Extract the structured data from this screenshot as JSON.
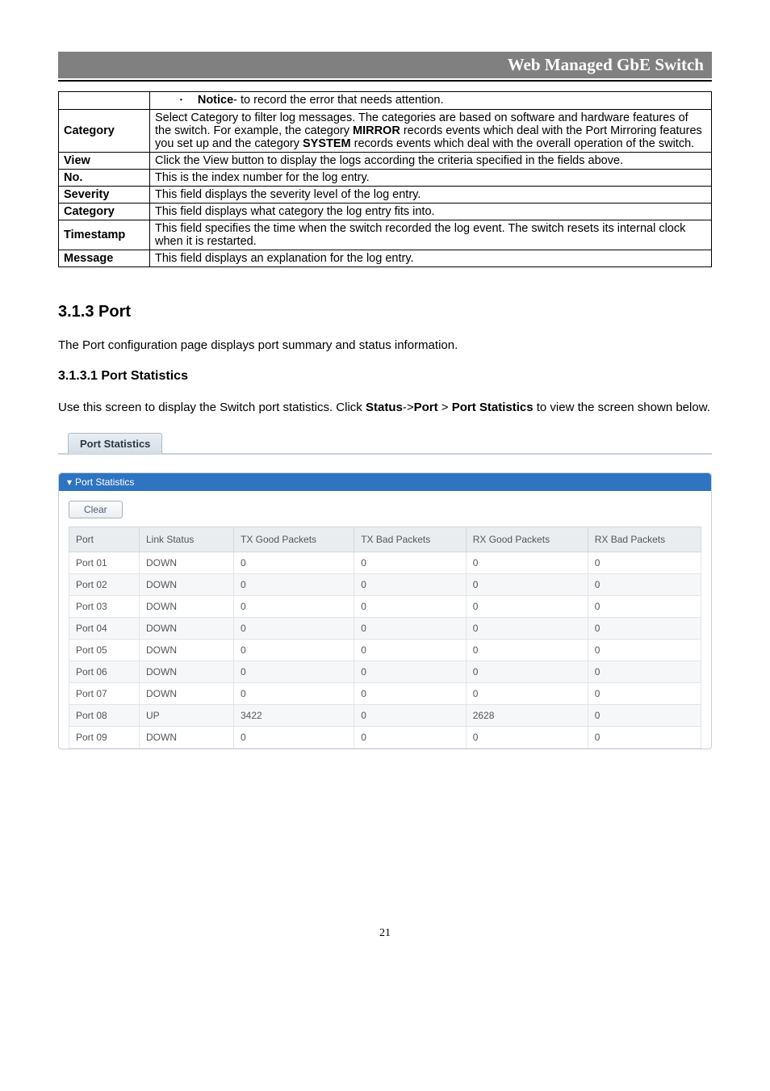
{
  "header": {
    "title": "Web Managed GbE Switch"
  },
  "def_table": {
    "notice_prefix": "Notice",
    "notice_text": "- to record the error that needs attention.",
    "rows": [
      {
        "label": "Category",
        "text_parts": [
          "Select Category to filter log messages. The categories are based on software and hardware features of the switch. For example, the category ",
          "MIRROR",
          " records events which deal with the Port Mirroring features you set up and the category ",
          "SYSTEM",
          " records events which deal with the overall operation of the switch."
        ]
      },
      {
        "label": "View",
        "text": "Click the View button to display the logs according the criteria specified in the fields above."
      },
      {
        "label": "No.",
        "text": "This is the index number for the log entry."
      },
      {
        "label": "Severity",
        "text": "This field displays the severity level of the log entry."
      },
      {
        "label": "Category",
        "text": "This field displays what category the log entry fits into."
      },
      {
        "label": "Timestamp",
        "text": "This field specifies the time when the switch recorded the log event. The switch resets its internal clock when it is restarted."
      },
      {
        "label": "Message",
        "text": "This field displays an explanation for the log entry."
      }
    ]
  },
  "sections": {
    "port_heading": "3.1.3 Port",
    "port_intro": "The Port configuration page displays port summary and status information.",
    "stats_heading": "3.1.3.1 Port Statistics",
    "stats_intro_1": "Use this screen to display the Switch port statistics. Click ",
    "stats_intro_bold1": "Status",
    "stats_intro_mid1": "->",
    "stats_intro_bold2": "Port",
    "stats_intro_mid2": " > ",
    "stats_intro_bold3": "Port Statistics",
    "stats_intro_2": " to view the screen shown below."
  },
  "tab_label": "Port Statistics",
  "panel_title": "Port Statistics",
  "clear_label": "Clear",
  "stats_headers": [
    "Port",
    "Link Status",
    "TX Good Packets",
    "TX Bad Packets",
    "RX Good Packets",
    "RX Bad Packets"
  ],
  "stats_rows": [
    {
      "port": "Port 01",
      "link": "DOWN",
      "txg": "0",
      "txb": "0",
      "rxg": "0",
      "rxb": "0"
    },
    {
      "port": "Port 02",
      "link": "DOWN",
      "txg": "0",
      "txb": "0",
      "rxg": "0",
      "rxb": "0"
    },
    {
      "port": "Port 03",
      "link": "DOWN",
      "txg": "0",
      "txb": "0",
      "rxg": "0",
      "rxb": "0"
    },
    {
      "port": "Port 04",
      "link": "DOWN",
      "txg": "0",
      "txb": "0",
      "rxg": "0",
      "rxb": "0"
    },
    {
      "port": "Port 05",
      "link": "DOWN",
      "txg": "0",
      "txb": "0",
      "rxg": "0",
      "rxb": "0"
    },
    {
      "port": "Port 06",
      "link": "DOWN",
      "txg": "0",
      "txb": "0",
      "rxg": "0",
      "rxb": "0"
    },
    {
      "port": "Port 07",
      "link": "DOWN",
      "txg": "0",
      "txb": "0",
      "rxg": "0",
      "rxb": "0"
    },
    {
      "port": "Port 08",
      "link": "UP",
      "txg": "3422",
      "txb": "0",
      "rxg": "2628",
      "rxb": "0"
    },
    {
      "port": "Port 09",
      "link": "DOWN",
      "txg": "0",
      "txb": "0",
      "rxg": "0",
      "rxb": "0"
    }
  ],
  "page_number": "21"
}
